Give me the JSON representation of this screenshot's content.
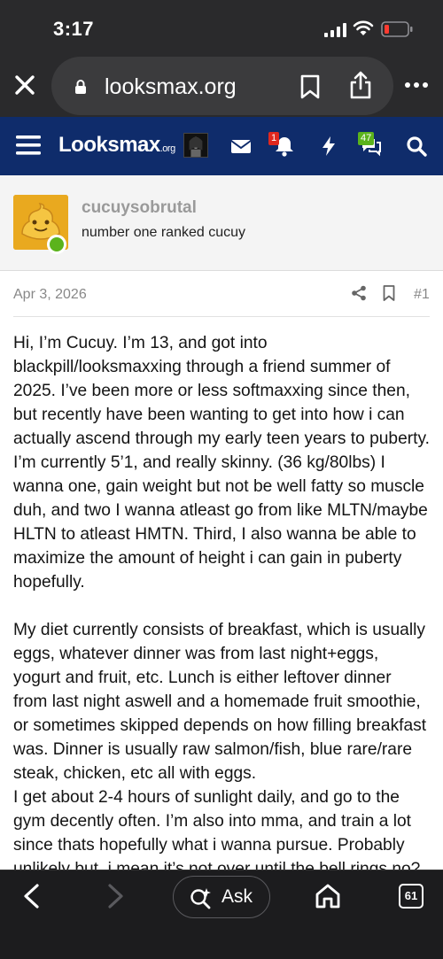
{
  "status_bar": {
    "time": "3:17"
  },
  "browser": {
    "url": "looksmax.org",
    "tab_count": "61",
    "ask_label": "Ask"
  },
  "site": {
    "logo_main": "Lo",
    "logo_oo": "o",
    "logo_rest": "ksmax",
    "logo_tld": ".org",
    "alerts_badge": "1",
    "conversations_badge": "47",
    "colors": {
      "nav_bg": "#0f2c6b",
      "alerts_badge": "#e0281e",
      "conversations_badge": "#5bb31c"
    }
  },
  "post": {
    "username": "cucuysobrutal",
    "user_title": "number one ranked cucuy",
    "date": "Apr 3, 2026",
    "post_number": "#1",
    "paragraphs": [
      "Hi, I’m Cucuy. I’m 13, and got into blackpill/looksmaxxing through a friend summer of 2025. I’ve been more or less softmaxxing since then, but recently have been wanting to get into how i can actually ascend through my early teen years to puberty. I’m currently 5’1, and really skinny. (36 kg/80lbs) I wanna one, gain weight but not be well fatty so muscle duh, and two I wanna atleast go from like MLTN/maybe HLTN to atleast HMTN. Third, I also wanna be able to maximize the amount of height i can gain in puberty hopefully.",
      "My diet currently consists of breakfast, which is usually eggs, whatever dinner was from last night+eggs, yogurt and fruit, etc. Lunch is either leftover dinner from last night aswell and a homemade fruit smoothie, or sometimes skipped depends on how filling breakfast was. Dinner is usually raw salmon/fish, blue rare/rare steak, chicken, etc all with eggs.",
      "I get about 2-4 hours of sunlight daily, and go to the gym decently often. I’m also into mma, and train a lot since thats hopefully what i wanna pursue. Probably unlikely but, i mean it’s not over until the bell rings no?"
    ]
  }
}
